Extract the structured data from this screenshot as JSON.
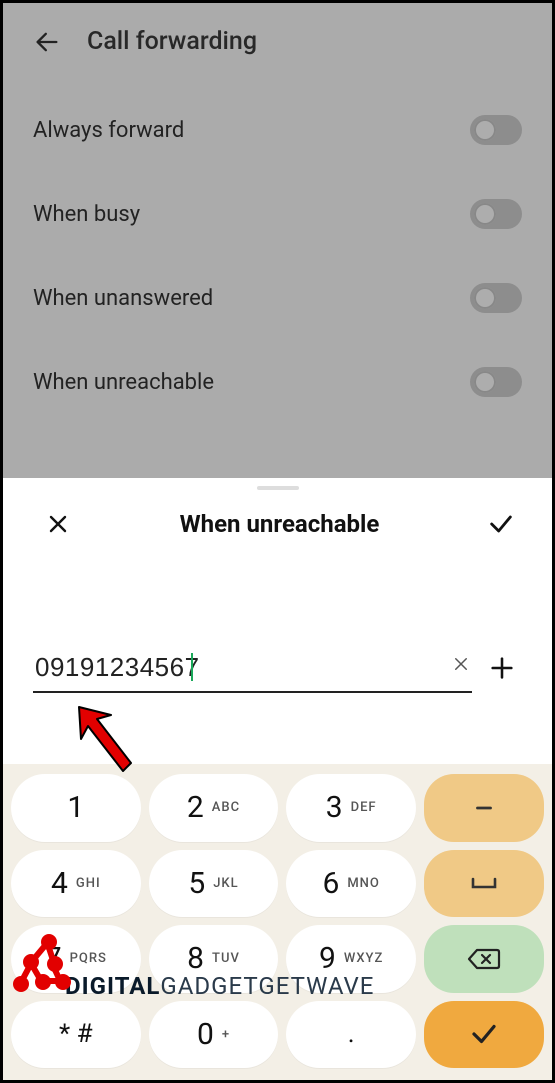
{
  "header": {
    "title": "Call forwarding"
  },
  "options": [
    {
      "label": "Always forward",
      "on": false
    },
    {
      "label": "When busy",
      "on": false
    },
    {
      "label": "When unanswered",
      "on": false
    },
    {
      "label": "When unreachable",
      "on": false
    }
  ],
  "sheet": {
    "title": "When unreachable",
    "number": "09191234567"
  },
  "keypad": {
    "k1": {
      "d": "1",
      "l": ""
    },
    "k2": {
      "d": "2",
      "l": "ABC"
    },
    "k3": {
      "d": "3",
      "l": "DEF"
    },
    "k4": {
      "d": "4",
      "l": "GHI"
    },
    "k5": {
      "d": "5",
      "l": "JKL"
    },
    "k6": {
      "d": "6",
      "l": "MNO"
    },
    "k7": {
      "d": "7",
      "l": "PQRS"
    },
    "k8": {
      "d": "8",
      "l": "TUV"
    },
    "k9": {
      "d": "9",
      "l": "WXYZ"
    },
    "kstar": {
      "d": "* #",
      "l": ""
    },
    "k0": {
      "d": "0",
      "l": "+"
    }
  },
  "watermark": {
    "bold": "DIGITAL",
    "light": "GADGETGETWAVE"
  }
}
